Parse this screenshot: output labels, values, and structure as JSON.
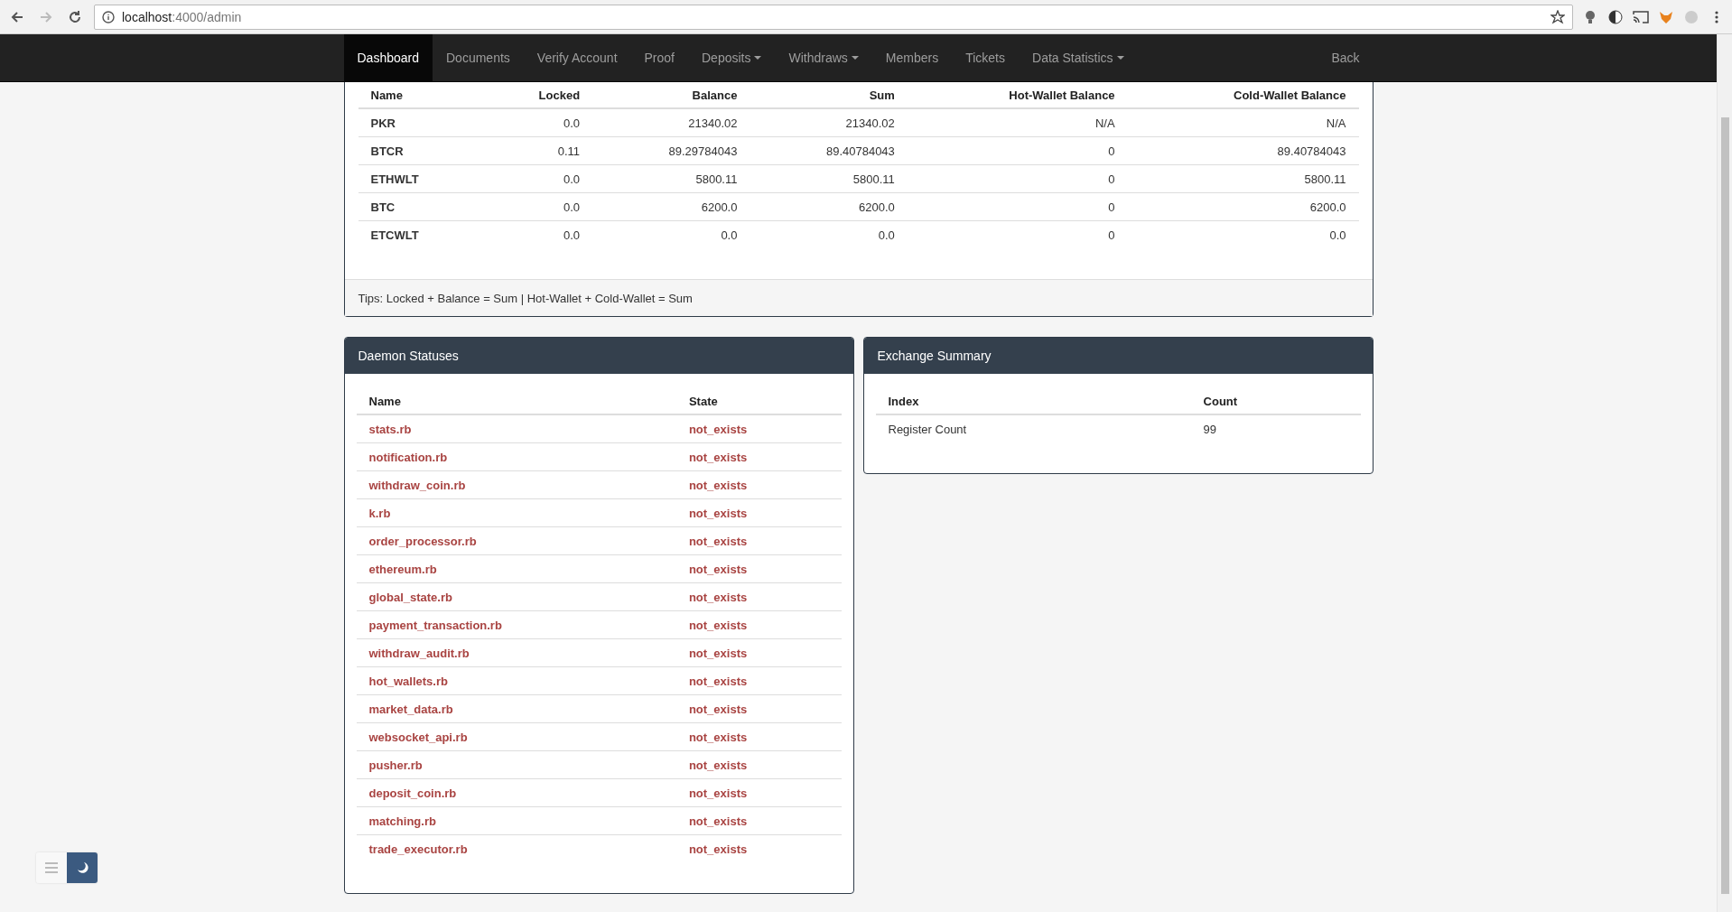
{
  "browser": {
    "host": "localhost",
    "path": ":4000/admin"
  },
  "nav": {
    "items": [
      {
        "label": "Dashboard",
        "selected": true,
        "dropdown": false
      },
      {
        "label": "Documents",
        "selected": false,
        "dropdown": false
      },
      {
        "label": "Verify Account",
        "selected": false,
        "dropdown": false
      },
      {
        "label": "Proof",
        "selected": false,
        "dropdown": false
      },
      {
        "label": "Deposits",
        "selected": false,
        "dropdown": true
      },
      {
        "label": "Withdraws",
        "selected": false,
        "dropdown": true
      },
      {
        "label": "Members",
        "selected": false,
        "dropdown": false
      },
      {
        "label": "Tickets",
        "selected": false,
        "dropdown": false
      },
      {
        "label": "Data Statistics",
        "selected": false,
        "dropdown": true
      }
    ],
    "right": "Back"
  },
  "balances": {
    "columns": [
      "Name",
      "Locked",
      "Balance",
      "Sum",
      "Hot-Wallet Balance",
      "Cold-Wallet Balance"
    ],
    "rows": [
      [
        "PKR",
        "0.0",
        "21340.02",
        "21340.02",
        "N/A",
        "N/A"
      ],
      [
        "BTCR",
        "0.11",
        "89.29784043",
        "89.40784043",
        "0",
        "89.40784043"
      ],
      [
        "ETHWLT",
        "0.0",
        "5800.11",
        "5800.11",
        "0",
        "5800.11"
      ],
      [
        "BTC",
        "0.0",
        "6200.0",
        "6200.0",
        "0",
        "6200.0"
      ],
      [
        "ETCWLT",
        "0.0",
        "0.0",
        "0.0",
        "0",
        "0.0"
      ]
    ],
    "tips": "Tips: Locked + Balance = Sum | Hot-Wallet + Cold-Wallet = Sum"
  },
  "daemons": {
    "title": "Daemon Statuses",
    "columns": [
      "Name",
      "State"
    ],
    "rows": [
      {
        "name": "stats.rb",
        "state": "not_exists"
      },
      {
        "name": "notification.rb",
        "state": "not_exists"
      },
      {
        "name": "withdraw_coin.rb",
        "state": "not_exists"
      },
      {
        "name": "k.rb",
        "state": "not_exists"
      },
      {
        "name": "order_processor.rb",
        "state": "not_exists"
      },
      {
        "name": "ethereum.rb",
        "state": "not_exists"
      },
      {
        "name": "global_state.rb",
        "state": "not_exists"
      },
      {
        "name": "payment_transaction.rb",
        "state": "not_exists"
      },
      {
        "name": "withdraw_audit.rb",
        "state": "not_exists"
      },
      {
        "name": "hot_wallets.rb",
        "state": "not_exists"
      },
      {
        "name": "market_data.rb",
        "state": "not_exists"
      },
      {
        "name": "websocket_api.rb",
        "state": "not_exists"
      },
      {
        "name": "pusher.rb",
        "state": "not_exists"
      },
      {
        "name": "deposit_coin.rb",
        "state": "not_exists"
      },
      {
        "name": "matching.rb",
        "state": "not_exists"
      },
      {
        "name": "trade_executor.rb",
        "state": "not_exists"
      }
    ]
  },
  "exchange": {
    "title": "Exchange Summary",
    "columns": [
      "Index",
      "Count"
    ],
    "rows": [
      [
        "Register Count",
        "99"
      ]
    ]
  }
}
